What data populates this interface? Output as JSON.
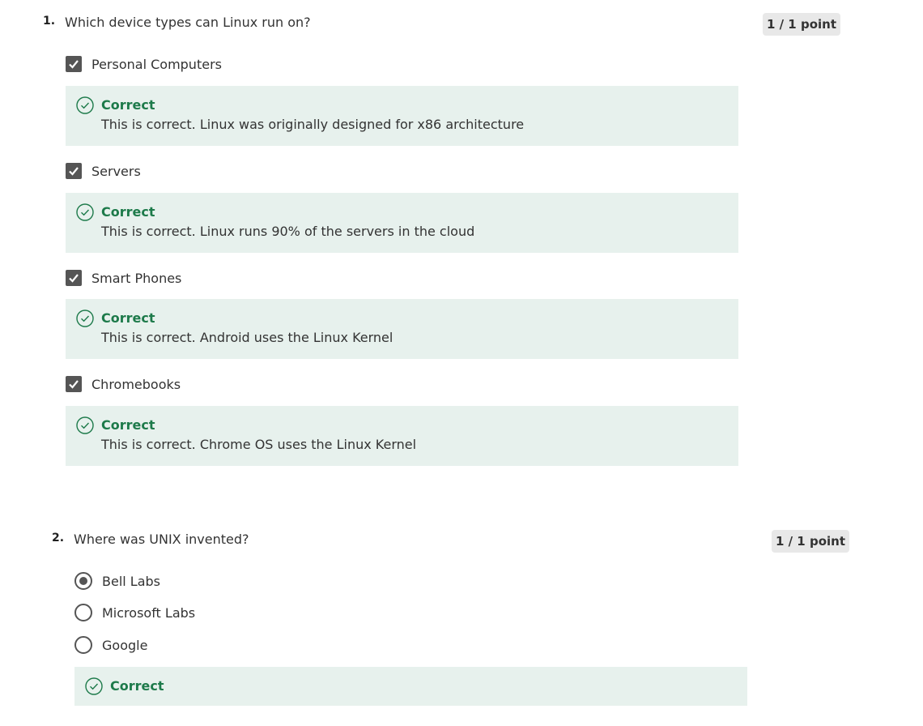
{
  "questions": [
    {
      "number": "1.",
      "text": "Which device types can Linux run on?",
      "points": "1 / 1 point",
      "options": [
        {
          "label": "Personal Computers",
          "checked": true,
          "feedback_title": "Correct",
          "feedback_text": "This is correct.  Linux was originally designed for x86 architecture"
        },
        {
          "label": "Servers",
          "checked": true,
          "feedback_title": "Correct",
          "feedback_text": "This is correct.  Linux runs 90% of the servers in the cloud"
        },
        {
          "label": "Smart Phones",
          "checked": true,
          "feedback_title": "Correct",
          "feedback_text": "This is correct. Android uses the Linux Kernel"
        },
        {
          "label": "Chromebooks",
          "checked": true,
          "feedback_title": "Correct",
          "feedback_text": "This is correct.  Chrome OS uses the Linux Kernel"
        }
      ]
    },
    {
      "number": "2.",
      "text": "Where was UNIX invented?",
      "points": "1 / 1 point",
      "options": [
        {
          "label": "Bell Labs",
          "selected": true
        },
        {
          "label": "Microsoft Labs",
          "selected": false
        },
        {
          "label": "Google",
          "selected": false
        }
      ],
      "feedback_title": "Correct"
    }
  ],
  "colors": {
    "feedback_bg": "#e7f1ed",
    "correct_green": "#1d7a4a",
    "checkbox_fill": "#555555",
    "points_badge_bg": "#e8e8e8"
  },
  "icons": {
    "checkbox": "checkmark-icon",
    "feedback": "check-circle-icon",
    "radio": "radio-icon"
  }
}
